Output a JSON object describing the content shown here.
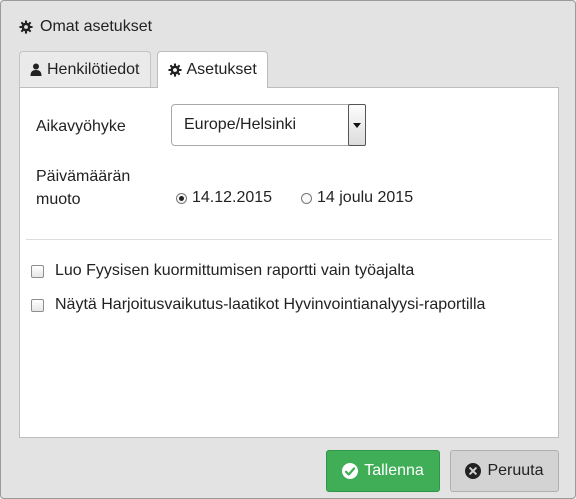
{
  "dialog": {
    "title": "Omat asetukset",
    "title_icon": "gear-icon"
  },
  "tabs": [
    {
      "label": "Henkilötiedot",
      "icon": "user-icon",
      "active": false
    },
    {
      "label": "Asetukset",
      "icon": "gear-icon",
      "active": true
    }
  ],
  "settings": {
    "timezone_label": "Aikavyöhyke",
    "timezone_value": "Europe/Helsinki",
    "date_format_label_line1": "Päivämäärän",
    "date_format_label_line2": "muoto",
    "date_format_options": [
      {
        "label": "14.12.2015",
        "checked": true
      },
      {
        "label": "14 joulu 2015",
        "checked": false
      }
    ],
    "checkboxes": [
      {
        "label": "Luo Fyysisen kuormittumisen raportti vain työajalta",
        "checked": false
      },
      {
        "label": "Näytä Harjoitusvaikutus-laatikot Hyvinvointianalyysi-raportilla",
        "checked": false
      }
    ]
  },
  "buttons": {
    "save_label": "Tallenna",
    "save_icon": "check-circle-icon",
    "save_color": "#3fae57",
    "cancel_label": "Peruuta",
    "cancel_icon": "times-circle-icon"
  }
}
